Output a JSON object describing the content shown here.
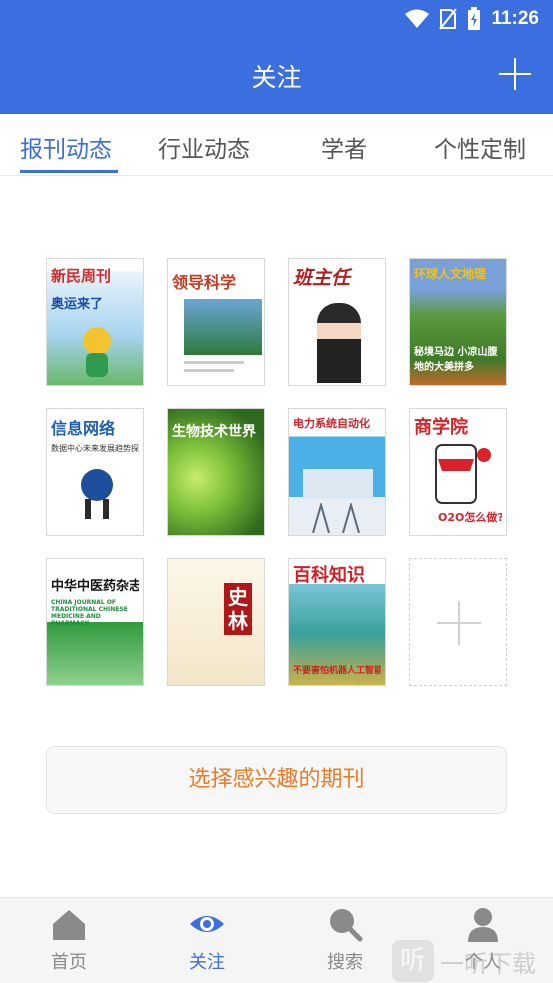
{
  "status_bar": {
    "time": "11:26"
  },
  "header": {
    "title": "关注"
  },
  "tabs": [
    {
      "label": "报刊动态",
      "active": true
    },
    {
      "label": "行业动态",
      "active": false
    },
    {
      "label": "学者",
      "active": false
    },
    {
      "label": "个性定制",
      "active": false
    }
  ],
  "magazines": [
    {
      "title": "新民周刊",
      "subtitle": "奥运来了",
      "accent": "#d62b2b"
    },
    {
      "title": "领导科学",
      "subtitle": "",
      "accent": "#c23b22"
    },
    {
      "title": "班主任",
      "subtitle": "",
      "accent": "#b31e1e"
    },
    {
      "title": "环球人文地理",
      "subtitle": "秘境马边 小凉山腹地的大美拼多",
      "accent": "#f2c21b"
    },
    {
      "title": "信息网络",
      "subtitle": "数据中心未来发展趋势探讨",
      "accent": "#1c5fb0"
    },
    {
      "title": "生物技术世界",
      "subtitle": "",
      "accent": "#ffffff"
    },
    {
      "title": "电力系统自动化",
      "subtitle": "",
      "accent": "#d0202a"
    },
    {
      "title": "商学院",
      "subtitle": "O2O怎么做?",
      "accent": "#d8232a"
    },
    {
      "title": "中华中医药杂志",
      "subtitle": "CHINA JOURNAL OF TRADITIONAL CHINESE MEDICINE AND PHARMACY",
      "accent": "#1c8f3a"
    },
    {
      "title": "史林",
      "subtitle": "",
      "accent": "#b01818"
    },
    {
      "title": "百科知识",
      "subtitle": "不要害怕机器人工智能",
      "accent": "#d21f26"
    }
  ],
  "select_button": "选择感兴趣的期刊",
  "bottom_nav": [
    {
      "label": "首页",
      "icon": "home-icon",
      "active": false
    },
    {
      "label": "关注",
      "icon": "eye-icon",
      "active": true
    },
    {
      "label": "搜索",
      "icon": "search-icon",
      "active": false
    },
    {
      "label": "个人",
      "icon": "user-icon",
      "active": false
    }
  ],
  "watermark": {
    "badge": "听",
    "text": "一听下载"
  },
  "colors": {
    "primary": "#3b6fe0",
    "accent_orange": "#ef7a27",
    "inactive": "#8a8a8a"
  }
}
